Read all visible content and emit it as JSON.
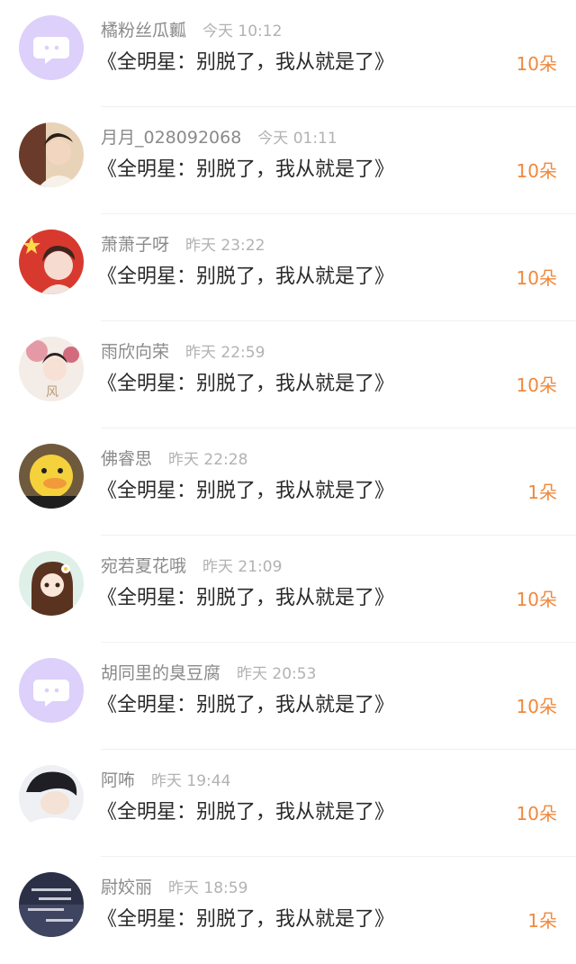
{
  "colors": {
    "accent": "#f0883c",
    "name": "#8a8a8a",
    "time": "#b2b2b2",
    "message": "#2a2a2a",
    "default_avatar": "#ddd0fa"
  },
  "comments": [
    {
      "name": "橘粉丝瓜瓤",
      "time": "今天 10:12",
      "message": "《全明星：别脱了，我从就是了》",
      "gift": "10朵",
      "avatar": "default-avatar-icon"
    },
    {
      "name": "月月_028092068",
      "time": "今天 01:11",
      "message": "《全明星：别脱了，我从就是了》",
      "gift": "10朵",
      "avatar": "user-photo"
    },
    {
      "name": "萧萧子呀",
      "time": "昨天 23:22",
      "message": "《全明星：别脱了，我从就是了》",
      "gift": "10朵",
      "avatar": "user-photo"
    },
    {
      "name": "雨欣向荣",
      "time": "昨天 22:59",
      "message": "《全明星：别脱了，我从就是了》",
      "gift": "10朵",
      "avatar": "user-photo"
    },
    {
      "name": "佛睿思",
      "time": "昨天 22:28",
      "message": "《全明星：别脱了，我从就是了》",
      "gift": "1朵",
      "avatar": "user-photo"
    },
    {
      "name": "宛若夏花哦",
      "time": "昨天 21:09",
      "message": "《全明星：别脱了，我从就是了》",
      "gift": "10朵",
      "avatar": "user-photo"
    },
    {
      "name": "胡同里的臭豆腐",
      "time": "昨天 20:53",
      "message": "《全明星：别脱了，我从就是了》",
      "gift": "10朵",
      "avatar": "default-avatar-icon"
    },
    {
      "name": "阿咘",
      "time": "昨天 19:44",
      "message": "《全明星：别脱了，我从就是了》",
      "gift": "10朵",
      "avatar": "user-photo"
    },
    {
      "name": "尉姣丽",
      "time": "昨天 18:59",
      "message": "《全明星：别脱了，我从就是了》",
      "gift": "1朵",
      "avatar": "user-photo"
    }
  ]
}
